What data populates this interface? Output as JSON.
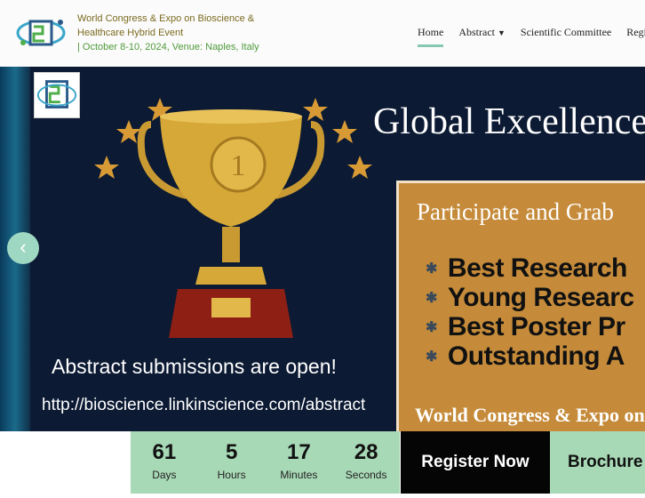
{
  "header": {
    "title_line1": "World Congress & Expo on Bioscience &",
    "title_line2": "Healthcare Hybrid Event",
    "dates": "| October 8-10, 2024, Venue: Naples, Italy",
    "nav": {
      "home": "Home",
      "abstract": "Abstract",
      "committee": "Scientific Committee",
      "register": "Regist"
    }
  },
  "hero": {
    "title": "Global Excellence",
    "prize_head": "Participate and Grab",
    "prizes": [
      "Best Research",
      "Young Researc",
      "Best Poster Pr",
      "Outstanding A"
    ],
    "prize_foot": "World Congress & Expo on",
    "submission_text": "Abstract submissions are open!",
    "url": "http://bioscience.linkinscience.com/abstract"
  },
  "countdown": [
    {
      "value": "61",
      "label": "Days"
    },
    {
      "value": "5",
      "label": "Hours"
    },
    {
      "value": "17",
      "label": "Minutes"
    },
    {
      "value": "28",
      "label": "Seconds"
    }
  ],
  "actions": {
    "register": "Register Now",
    "brochure": "Brochure"
  },
  "colors": {
    "accent_green": "#a8d9b6",
    "nav_underline": "#86c8b3",
    "hero_bg": "#0c1a33",
    "prize_box": "#c58b3a"
  }
}
